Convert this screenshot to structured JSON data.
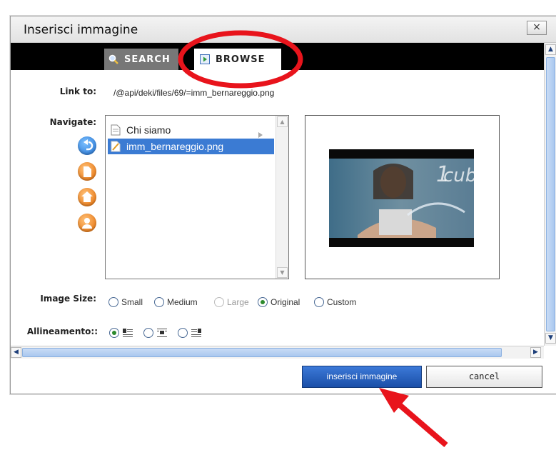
{
  "dialog": {
    "title": "Inserisci immagine",
    "close_label": "×"
  },
  "tabs": [
    {
      "label": "SEARCH",
      "icon": "magnifier-icon",
      "active": false
    },
    {
      "label": "BROWSE",
      "icon": "browse-folder-icon",
      "active": true
    }
  ],
  "link_to": {
    "label": "Link to:",
    "value": "/@api/deki/files/69/=imm_bernareggio.png"
  },
  "navigate": {
    "label": "Navigate:",
    "buttons": [
      "back-icon",
      "page-icon",
      "home-icon",
      "user-icon"
    ],
    "items": [
      {
        "name": "Chi siamo",
        "icon": "page-icon",
        "selected": false,
        "has_children": true
      },
      {
        "name": "imm_bernareggio.png",
        "icon": "image-file-icon",
        "selected": true,
        "has_children": false
      }
    ]
  },
  "preview": {
    "image_text": "cubo"
  },
  "image_size": {
    "label": "Image Size:",
    "options": [
      {
        "label": "Small",
        "checked": false,
        "disabled": false
      },
      {
        "label": "Medium",
        "checked": false,
        "disabled": false
      },
      {
        "label": "Large",
        "checked": false,
        "disabled": true
      },
      {
        "label": "Original",
        "checked": true,
        "disabled": false
      },
      {
        "label": "Custom",
        "checked": false,
        "disabled": false
      }
    ]
  },
  "alignment": {
    "label": "Allineamento::",
    "options": [
      {
        "icon": "align-left-icon",
        "checked": true
      },
      {
        "icon": "align-center-icon",
        "checked": false
      },
      {
        "icon": "align-right-icon",
        "checked": false
      }
    ]
  },
  "buttons": {
    "insert_label": "inserisci immagine",
    "cancel_label": "cancel"
  },
  "annotation_color": "#e8141c"
}
